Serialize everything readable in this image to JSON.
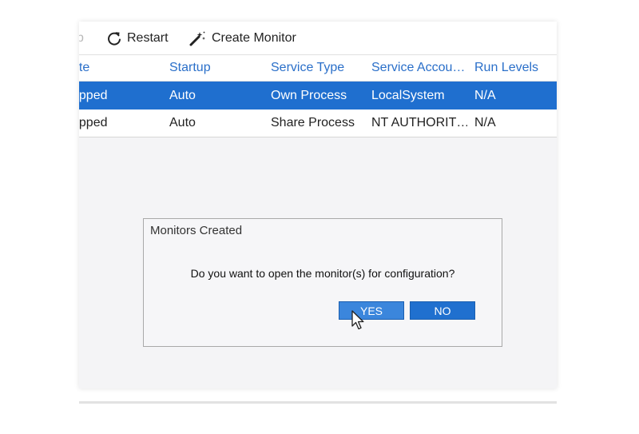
{
  "toolbar": {
    "faded_label": "p",
    "restart_label": "Restart",
    "create_monitor_label": "Create Monitor",
    "restart_icon": "refresh-icon",
    "create_monitor_icon": "magic-wand-icon"
  },
  "table": {
    "columns": [
      "ate",
      "Startup",
      "Service Type",
      "Service Accou…",
      "Run Levels"
    ],
    "rows": [
      {
        "state": "opped",
        "startup": "Auto",
        "service_type": "Own Process",
        "service_account": "LocalSystem",
        "run_levels": "N/A",
        "selected": true
      },
      {
        "state": "opped",
        "startup": "Auto",
        "service_type": "Share Process",
        "service_account": "NT AUTHORIT…",
        "run_levels": "N/A",
        "selected": false
      }
    ]
  },
  "dialog": {
    "title": "Monitors Created",
    "message": "Do you want to open the monitor(s) for configuration?",
    "yes_label": "YES",
    "no_label": "NO"
  },
  "colors": {
    "accent": "#1f6fcf",
    "header_text": "#2a6fc9",
    "yes_button": "#3b86dc",
    "no_button": "#2070cf"
  }
}
